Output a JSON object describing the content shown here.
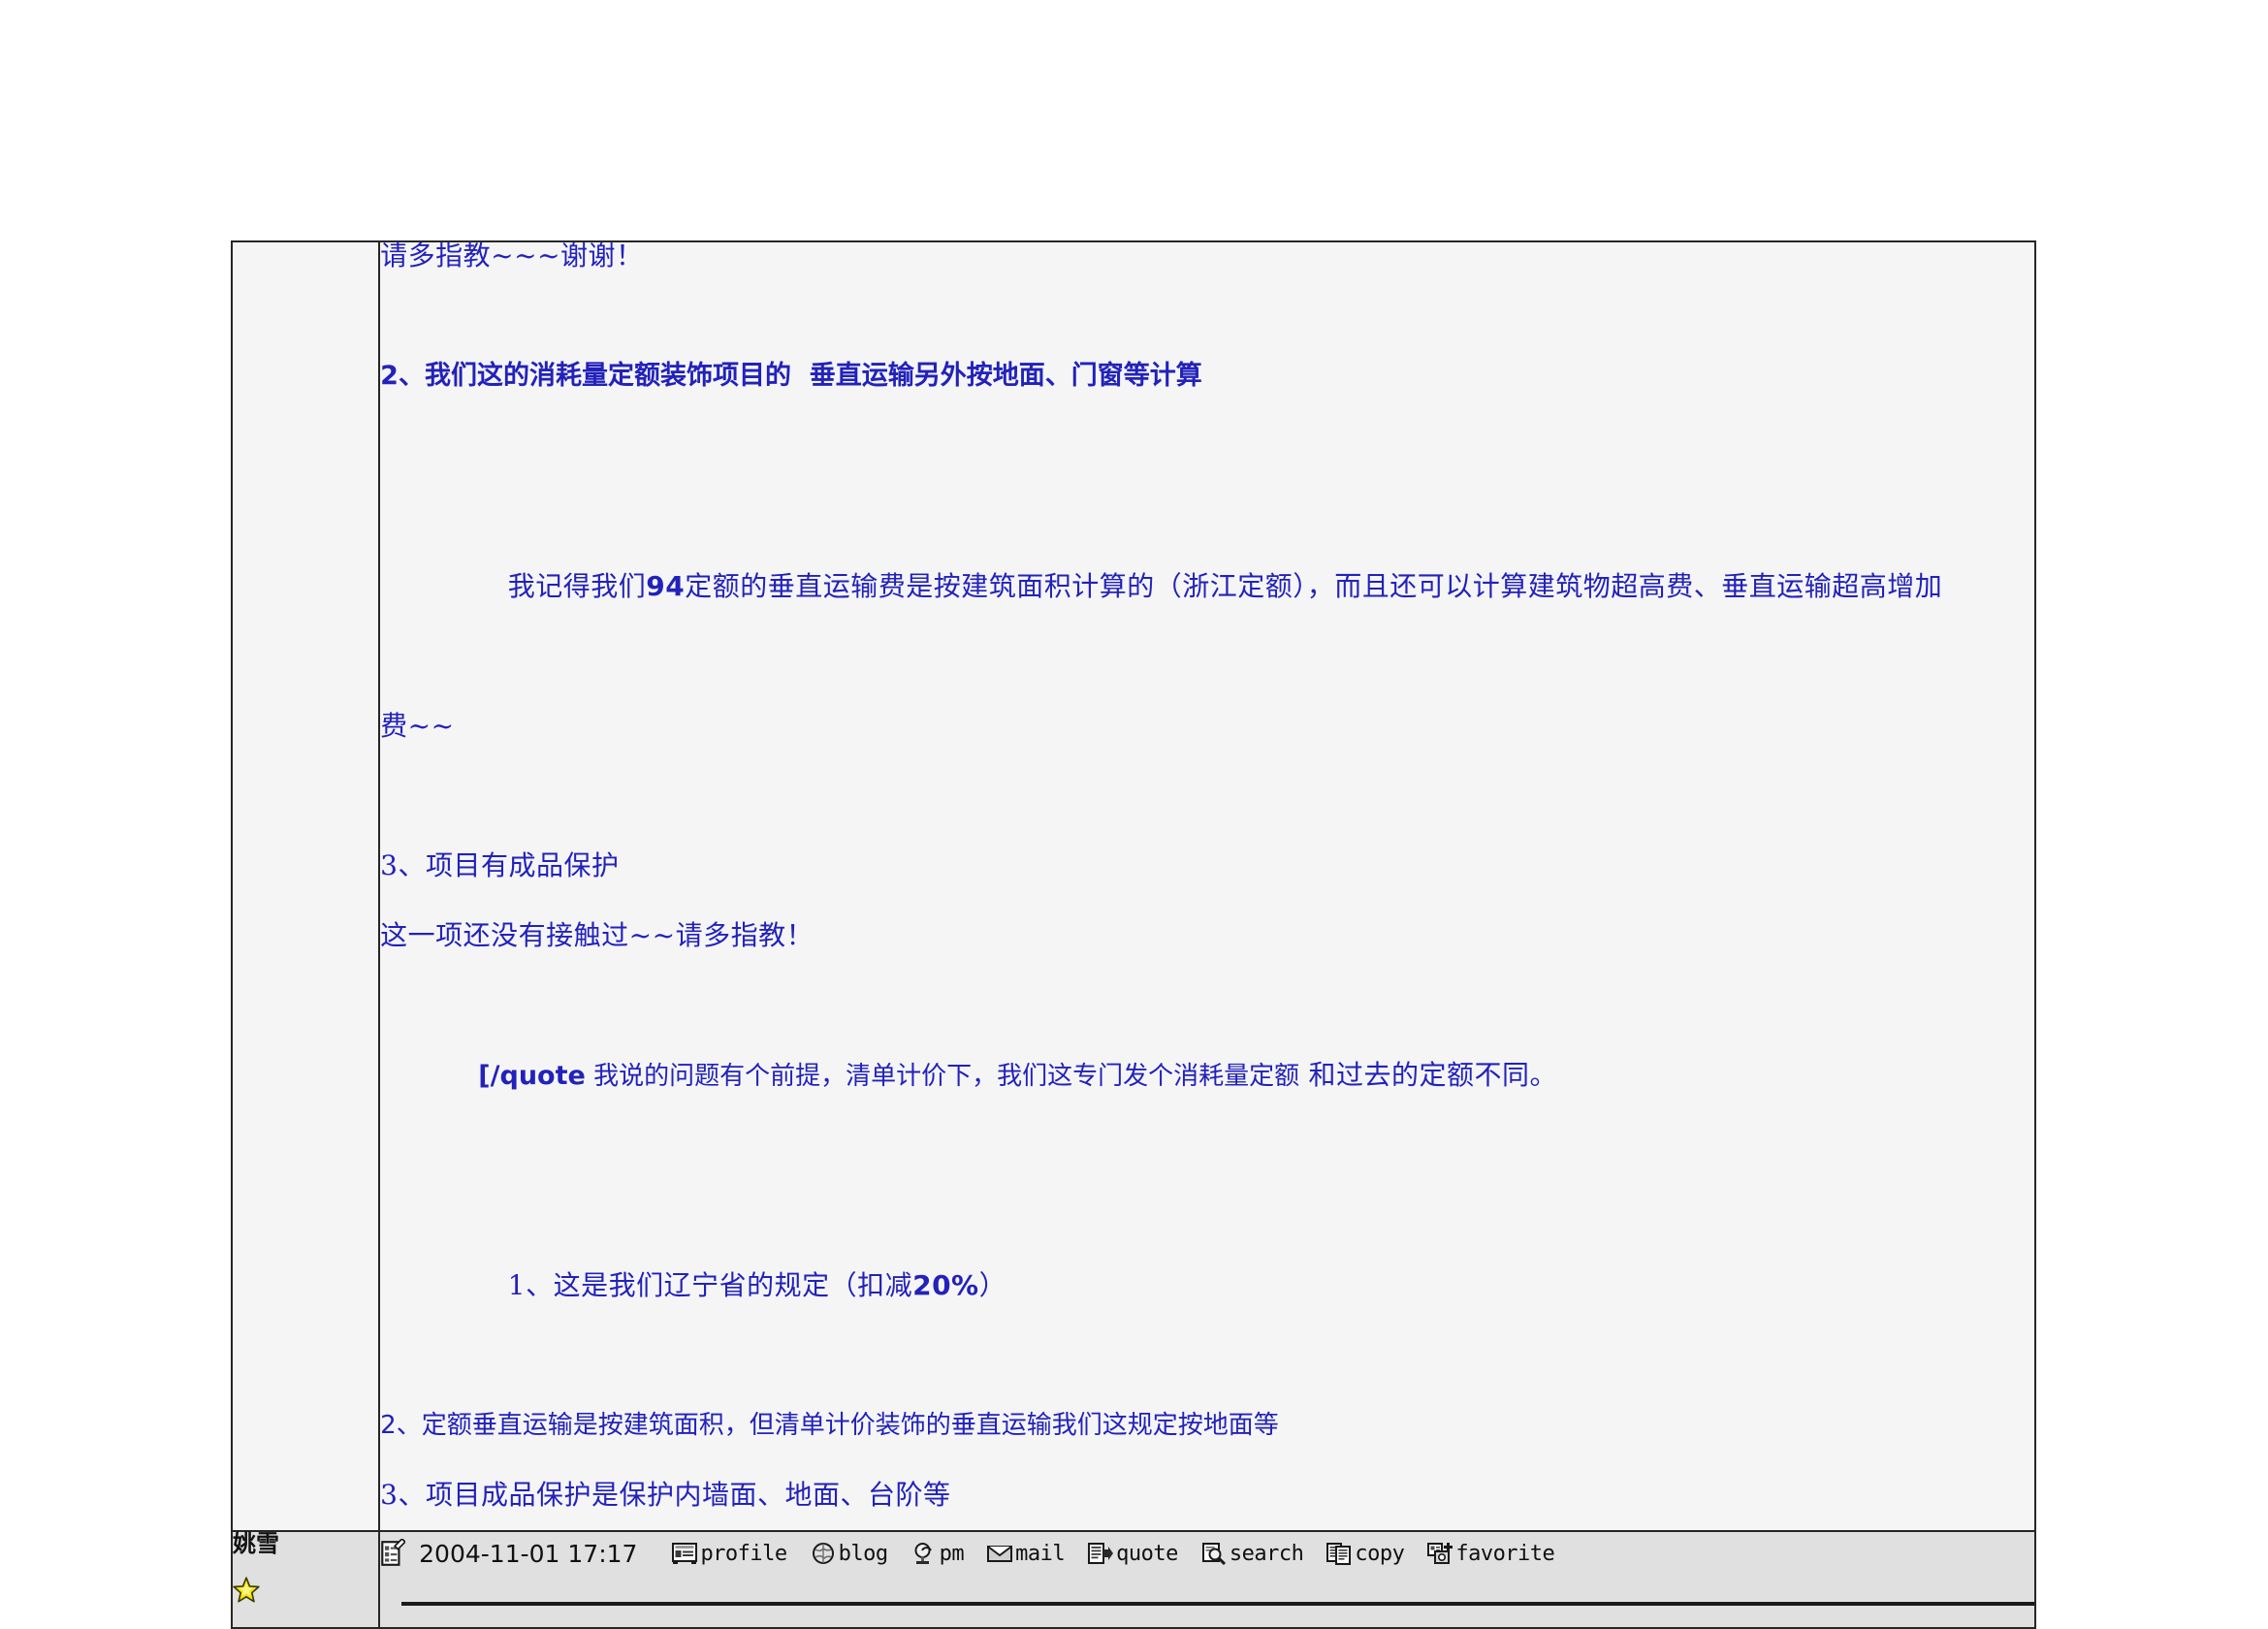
{
  "post": {
    "author": {
      "name": "姚雪",
      "rank_icon": "star-icon"
    },
    "body": {
      "line_1": "请多指教~~~谢谢！",
      "line_2": "2、我们这的消耗量定额装饰项目的  垂直运输另外按地面、门窗等计算",
      "line_3_a": "我记得我们",
      "line_3_num": "94",
      "line_3_b": "定额的垂直运输费是按建筑面积计算的（浙江定额），而且还可以计算建筑物超高费、垂直运输超高增加",
      "line_3_c": "费~~",
      "line_4": "3、项目有成品保护",
      "line_5": "这一项还没有接触过~~请多指教！",
      "line_6_tag": "[/quote",
      "line_6_hei": " 我说的问题有个前提，清单计价下，我们这专门发个消耗量定额",
      "line_6_serif": " 和过去的定额不同。",
      "line_7_a": "1、这是我们辽宁省的规定（扣减",
      "line_7_num": "20%",
      "line_7_b": "）",
      "line_8": "2、定额垂直运输是按建筑面积，但清单计价装饰的垂直运输我们这规定按地面等",
      "line_9": "3、项目成品保护是保护内墙面、地面、台阶等"
    },
    "footer": {
      "date": "2004-11-01 17:17",
      "date_icon": "post-stamp-icon",
      "actions": [
        {
          "label": "profile",
          "icon": "profile-icon"
        },
        {
          "label": "blog",
          "icon": "blog-icon"
        },
        {
          "label": "pm",
          "icon": "pm-icon"
        },
        {
          "label": "mail",
          "icon": "mail-icon"
        },
        {
          "label": "quote",
          "icon": "quote-icon"
        },
        {
          "label": "search",
          "icon": "search-icon"
        },
        {
          "label": "copy",
          "icon": "copy-icon"
        },
        {
          "label": "favorite",
          "icon": "favorite-icon"
        }
      ]
    }
  },
  "colors": {
    "post_text": "#2222bb",
    "cell_background": "#f5f5f5",
    "footer_background": "#e0e0e0",
    "border": "#262626",
    "star": "#f5e400"
  }
}
